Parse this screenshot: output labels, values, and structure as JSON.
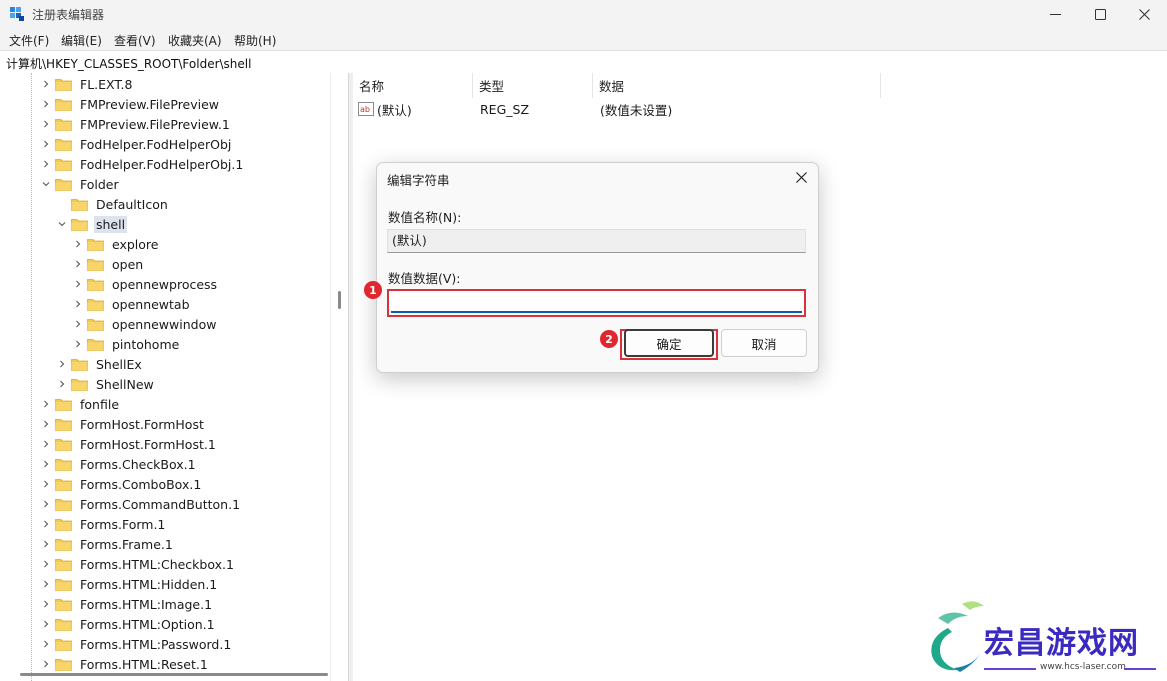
{
  "window": {
    "title": "注册表编辑器",
    "icon": "registry-editor-icon",
    "controls": [
      "minimize-icon",
      "maximize-icon",
      "close-icon"
    ]
  },
  "menu": [
    "文件(F)",
    "编辑(E)",
    "查看(V)",
    "收藏夹(A)",
    "帮助(H)"
  ],
  "address": "计算机\\HKEY_CLASSES_ROOT\\Folder\\shell",
  "tree": [
    {
      "label": "FL.EXT.8",
      "level": 0,
      "expander": "collapsed"
    },
    {
      "label": "FMPreview.FilePreview",
      "level": 0,
      "expander": "collapsed"
    },
    {
      "label": "FMPreview.FilePreview.1",
      "level": 0,
      "expander": "collapsed"
    },
    {
      "label": "FodHelper.FodHelperObj",
      "level": 0,
      "expander": "collapsed"
    },
    {
      "label": "FodHelper.FodHelperObj.1",
      "level": 0,
      "expander": "collapsed"
    },
    {
      "label": "Folder",
      "level": 0,
      "expander": "expanded"
    },
    {
      "label": "DefaultIcon",
      "level": 1,
      "expander": "none"
    },
    {
      "label": "shell",
      "level": 1,
      "expander": "expanded",
      "selected": true
    },
    {
      "label": "explore",
      "level": 2,
      "expander": "collapsed"
    },
    {
      "label": "open",
      "level": 2,
      "expander": "collapsed"
    },
    {
      "label": "opennewprocess",
      "level": 2,
      "expander": "collapsed"
    },
    {
      "label": "opennewtab",
      "level": 2,
      "expander": "collapsed"
    },
    {
      "label": "opennewwindow",
      "level": 2,
      "expander": "collapsed"
    },
    {
      "label": "pintohome",
      "level": 2,
      "expander": "collapsed"
    },
    {
      "label": "ShellEx",
      "level": 1,
      "expander": "collapsed"
    },
    {
      "label": "ShellNew",
      "level": 1,
      "expander": "collapsed"
    },
    {
      "label": "fonfile",
      "level": 0,
      "expander": "collapsed"
    },
    {
      "label": "FormHost.FormHost",
      "level": 0,
      "expander": "collapsed"
    },
    {
      "label": "FormHost.FormHost.1",
      "level": 0,
      "expander": "collapsed"
    },
    {
      "label": "Forms.CheckBox.1",
      "level": 0,
      "expander": "collapsed"
    },
    {
      "label": "Forms.ComboBox.1",
      "level": 0,
      "expander": "collapsed"
    },
    {
      "label": "Forms.CommandButton.1",
      "level": 0,
      "expander": "collapsed"
    },
    {
      "label": "Forms.Form.1",
      "level": 0,
      "expander": "collapsed"
    },
    {
      "label": "Forms.Frame.1",
      "level": 0,
      "expander": "collapsed"
    },
    {
      "label": "Forms.HTML:Checkbox.1",
      "level": 0,
      "expander": "collapsed"
    },
    {
      "label": "Forms.HTML:Hidden.1",
      "level": 0,
      "expander": "collapsed"
    },
    {
      "label": "Forms.HTML:Image.1",
      "level": 0,
      "expander": "collapsed"
    },
    {
      "label": "Forms.HTML:Option.1",
      "level": 0,
      "expander": "collapsed"
    },
    {
      "label": "Forms.HTML:Password.1",
      "level": 0,
      "expander": "collapsed"
    },
    {
      "label": "Forms.HTML:Reset.1",
      "level": 0,
      "expander": "collapsed"
    }
  ],
  "values_table": {
    "columns": [
      "名称",
      "类型",
      "数据"
    ],
    "rows": [
      {
        "icon": "string-value-icon",
        "name": "(默认)",
        "type": "REG_SZ",
        "data": "(数值未设置)"
      }
    ]
  },
  "dialog": {
    "title": "编辑字符串",
    "name_label": "数值名称(N):",
    "name_value": "(默认)",
    "data_label": "数值数据(V):",
    "data_value": "",
    "ok_label": "确定",
    "cancel_label": "取消",
    "step_badges": [
      "1",
      "2"
    ]
  },
  "watermark": {
    "text": "宏昌游戏网",
    "url": "www.hcs-laser.com"
  },
  "colors": {
    "highlight_red": "#d9323b",
    "badge_red": "#e0262f",
    "selection": "#dde3ec",
    "folder_yellow": "#f6c94a",
    "input_focus": "#0a5ca8"
  }
}
